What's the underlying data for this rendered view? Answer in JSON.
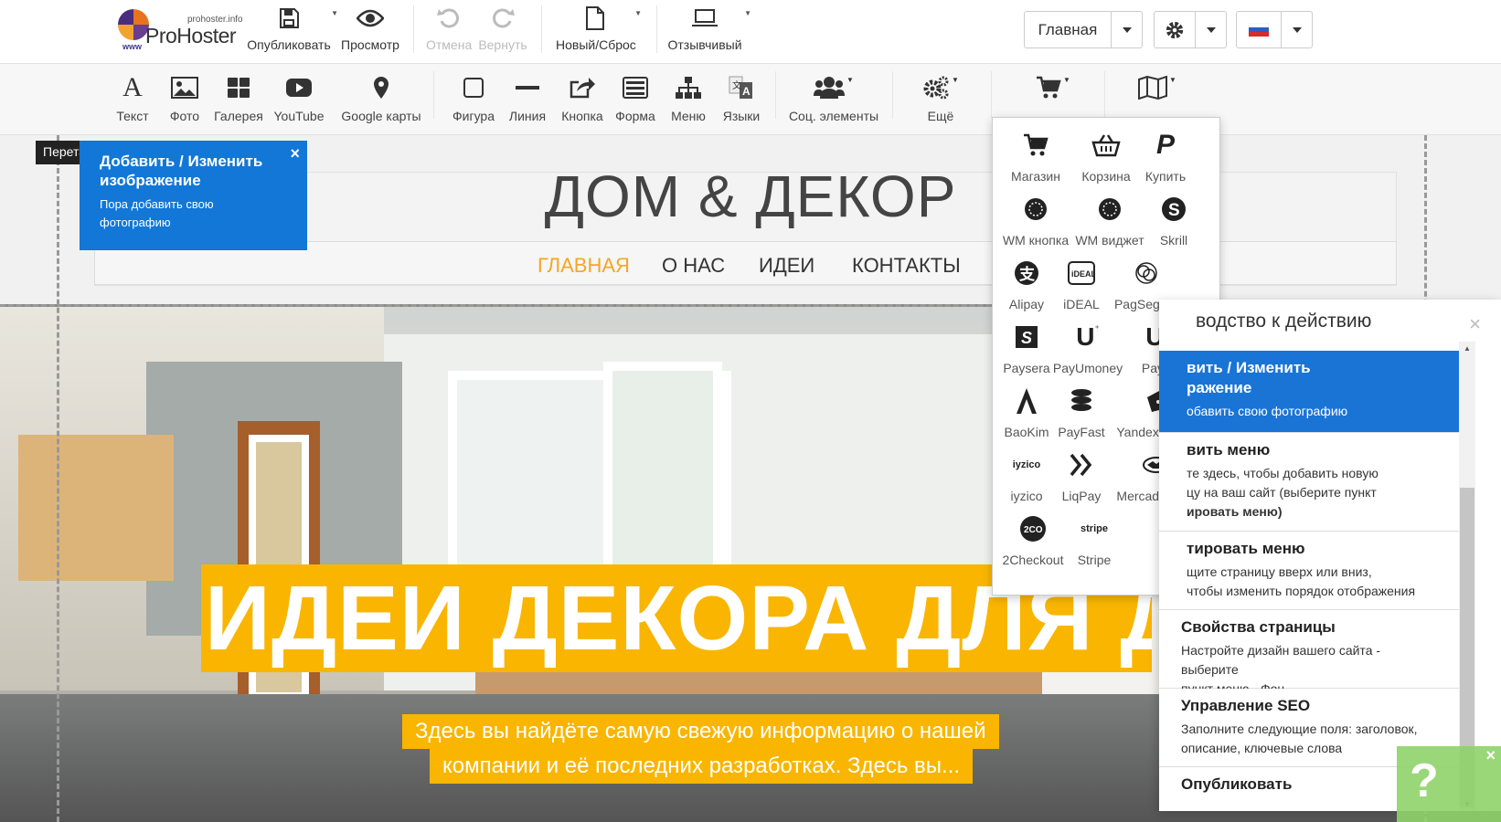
{
  "topbar": {
    "logo_name": "ProHoster",
    "logo_site": "prohoster.info",
    "logo_www": "www",
    "buttons": [
      {
        "label": "Опубликовать",
        "icon": "floppy-icon"
      },
      {
        "label": "Просмотр",
        "icon": "eye-icon"
      },
      {
        "label": "Отмена",
        "icon": "undo-icon"
      },
      {
        "label": "Вернуть",
        "icon": "redo-icon"
      },
      {
        "label": "Новый/Сброс",
        "icon": "file-icon"
      },
      {
        "label": "Отзывчивый",
        "icon": "laptop-icon"
      }
    ],
    "page_select": "Главная"
  },
  "toolbar": [
    {
      "label": "Текст"
    },
    {
      "label": "Фото"
    },
    {
      "label": "Галерея"
    },
    {
      "label": "YouTube"
    },
    {
      "label": "Google карты"
    },
    {
      "label": "Фигура"
    },
    {
      "label": "Линия"
    },
    {
      "label": "Кнопка"
    },
    {
      "label": "Форма"
    },
    {
      "label": "Меню"
    },
    {
      "label": "Языки"
    },
    {
      "label": "Соц. элементы"
    },
    {
      "label": "Ещё"
    }
  ],
  "site": {
    "title": "ДОМ & ДЕКОР",
    "nav": [
      "ГЛАВНАЯ",
      "О НАС",
      "ИДЕИ",
      "КОНТАКТЫ"
    ],
    "hero_title": "ИДЕИ ДЕКОРА ДЛЯ ДО",
    "hero_sub1": "Здесь вы найдёте самую свежую информацию о нашей",
    "hero_sub2": "компании и её последних разработках. Здесь вы..."
  },
  "tooltip": {
    "title": "Добавить / Изменить изображение",
    "desc": "Пора добавить свою фотографию",
    "close": "×",
    "side_label": "Перетащите"
  },
  "shop_menu": [
    "Магазин",
    "Корзина",
    "Купить",
    "WM кнопка",
    "WM виджет",
    "Skrill",
    "Alipay",
    "iDEAL",
    "PagSeguro",
    "Paysera",
    "PayUmoney",
    "PayU",
    "BaoKim",
    "PayFast",
    "Yandex Kassa",
    "iyzico",
    "LiqPay",
    "MercadoPago",
    "2Checkout",
    "Stripe"
  ],
  "shop_icon_text": {
    "iyzico": "iyzico",
    "ideal": "iDEAL",
    "twoco": "2CO",
    "stripe": "stripe"
  },
  "guide": {
    "title": "водство к действию",
    "close": "×",
    "items": [
      {
        "title": "вить / Изменить",
        "title2": "ражение",
        "desc": "обавить свою фотографию"
      },
      {
        "title": "вить меню",
        "desc": "те здесь, чтобы добавить новую",
        "desc2": "цу на ваш сайт (выберите пункт",
        "desc3": "ировать меню)"
      },
      {
        "title": "тировать меню",
        "desc": "щите страницу вверх или вниз,",
        "desc2": "чтобы изменить порядок отображения"
      },
      {
        "title": "Свойства страницы",
        "desc": "Настройте дизайн вашего сайта - выберите",
        "desc2": "пункт меню - Фон"
      },
      {
        "title": "Управление SEO",
        "desc": "Заполните следующие поля: заголовок,",
        "desc2": "описание, ключевые слова"
      },
      {
        "title": "Опубликовать"
      }
    ]
  },
  "help": {
    "symbol": "?",
    "close": "×"
  }
}
